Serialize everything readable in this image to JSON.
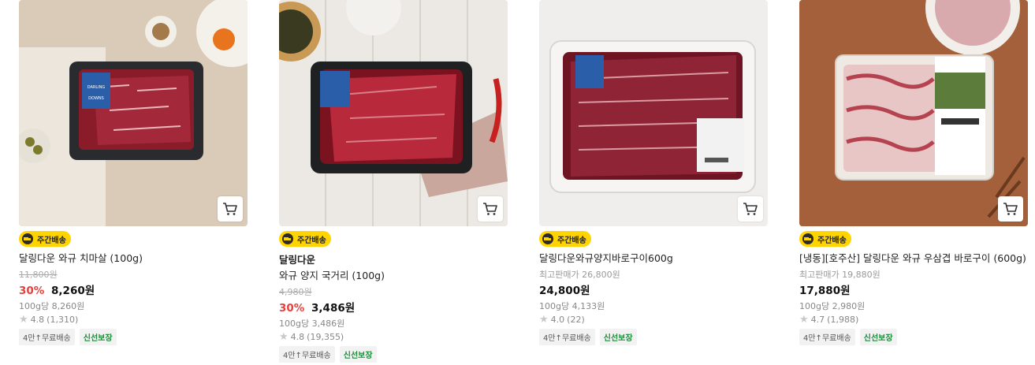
{
  "products": [
    {
      "badge": "주간배송",
      "title": "달링다운 와규 치마살 (100g)",
      "orig_price": "11,800원",
      "discount": "30%",
      "price": "8,260원",
      "unit_price": "100g당 8,260원",
      "rating": "4.8",
      "reviews": "(1,310)",
      "tag_shipping": "4만↑무료배송",
      "tag_fresh": "신선보장"
    },
    {
      "badge": "주간배송",
      "brand": "달링다운",
      "title": "와규 양지 국거리 (100g)",
      "orig_price": "4,980원",
      "discount": "30%",
      "price": "3,486원",
      "unit_price": "100g당 3,486원",
      "rating": "4.8",
      "reviews": "(19,355)",
      "tag_shipping": "4만↑무료배송",
      "tag_fresh": "신선보장"
    },
    {
      "badge": "주간배송",
      "title": "달링다운와규양지바로구이600g",
      "ref_price": "최고판매가 26,800원",
      "price": "24,800원",
      "unit_price": "100g당 4,133원",
      "rating": "4.0",
      "reviews": "(22)",
      "tag_shipping": "4만↑무료배송",
      "tag_fresh": "신선보장"
    },
    {
      "badge": "주간배송",
      "title": "[냉동][호주산] 달링다운 와규 우삼겹 바로구이 (600g)",
      "ref_price": "최고판매가 19,880원",
      "price": "17,880원",
      "unit_price": "100g당 2,980원",
      "rating": "4.7",
      "reviews": "(1,988)",
      "tag_shipping": "4만↑무료배송",
      "tag_fresh": "신선보장"
    }
  ]
}
